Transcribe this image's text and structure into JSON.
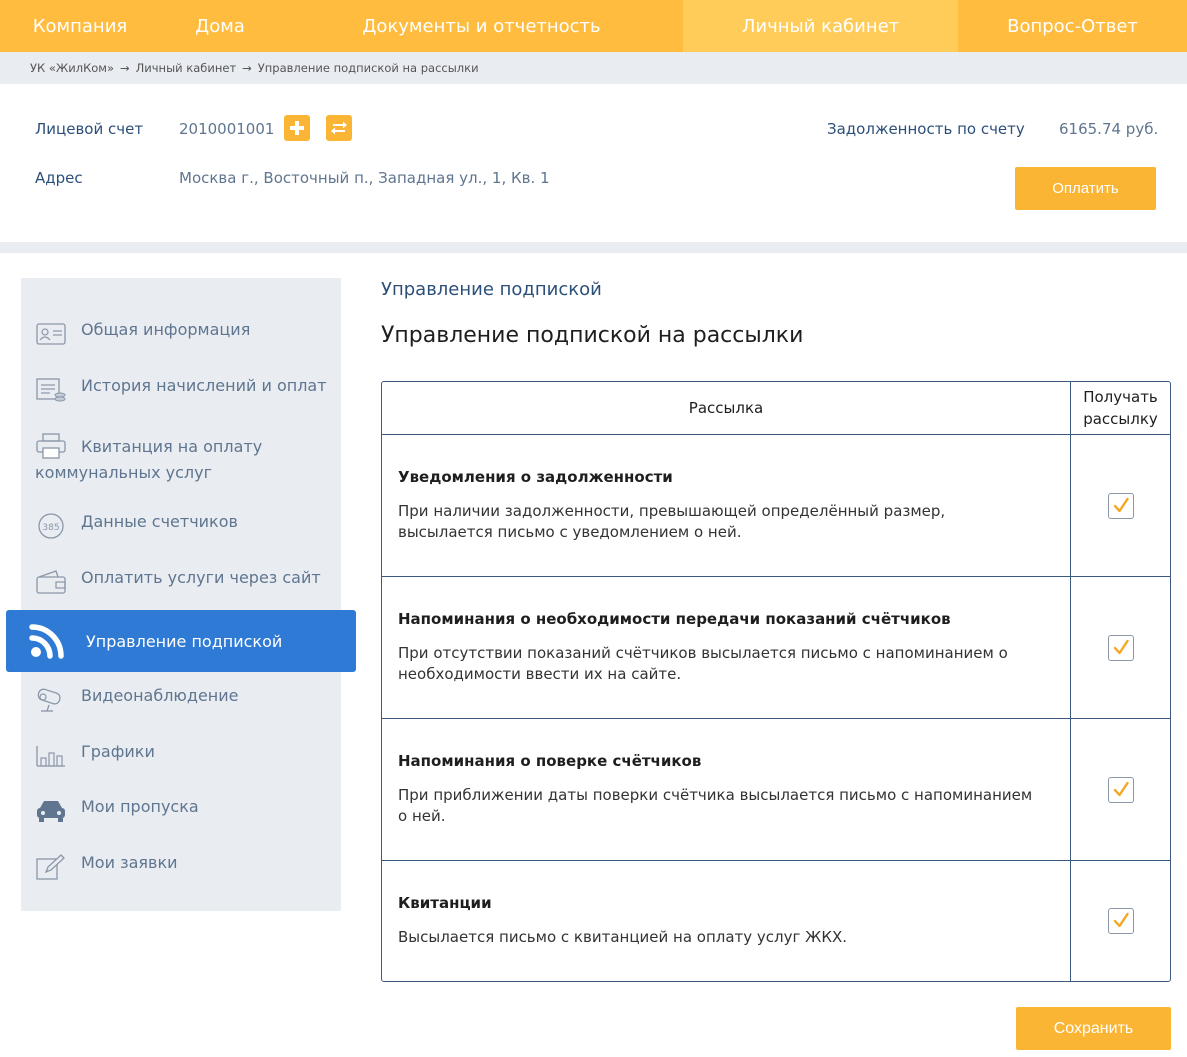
{
  "nav": {
    "items": [
      {
        "label": "Компания"
      },
      {
        "label": "Дома"
      },
      {
        "label": "Документы и отчетность"
      },
      {
        "label": "Личный кабинет"
      },
      {
        "label": "Вопрос-Ответ"
      }
    ],
    "active_index": 3
  },
  "breadcrumb": {
    "items": [
      {
        "label": "УК «ЖилКом»"
      },
      {
        "label": "Личный кабинет"
      },
      {
        "label": "Управление подпиской на рассылки"
      }
    ],
    "separator": "→"
  },
  "account": {
    "account_label": "Лицевой счет",
    "account_number": "2010001001",
    "address_label": "Адрес",
    "address_value": "Москва г., Восточный п., Западная ул., 1, Кв. 1",
    "debt_label": "Задолженность по счету",
    "debt_value": "6165.74 руб.",
    "pay_button": "Оплатить",
    "add_icon": "plus-icon",
    "switch_icon": "swap-icon"
  },
  "sidebar": {
    "items": [
      {
        "label": "Общая информация",
        "icon": "id-card-icon"
      },
      {
        "label": "История начислений и оплат",
        "icon": "history-icon"
      },
      {
        "label": "Квитанция на оплату",
        "label2": "коммунальных услуг",
        "icon": "printer-icon"
      },
      {
        "label": "Данные счетчиков",
        "icon": "meter-icon"
      },
      {
        "label": "Оплатить услуги через сайт",
        "icon": "wallet-icon"
      },
      {
        "label": "Управление подпиской",
        "icon": "rss-icon"
      },
      {
        "label": "Видеонаблюдение",
        "icon": "camera-icon"
      },
      {
        "label": "Графики",
        "icon": "chart-icon"
      },
      {
        "label": "Мои пропуска",
        "icon": "car-icon"
      },
      {
        "label": "Мои заявки",
        "icon": "edit-icon"
      }
    ],
    "active_index": 5
  },
  "page": {
    "subtitle": "Управление подпиской",
    "title": "Управление подпиской на рассылки"
  },
  "table": {
    "col_mailing": "Рассылка",
    "col_receive_line1": "Получать",
    "col_receive_line2": "рассылку",
    "rows": [
      {
        "title": "Уведомления о задолженности",
        "desc1": "При наличии задолженности, превышающей определённый размер,",
        "desc2": "высылается письмо с уведомлением о ней.",
        "checked": true
      },
      {
        "title": "Напоминания о необходимости передачи показаний счётчиков",
        "desc1": "При отсутствии показаний счётчиков высылается письмо с напоминанием о",
        "desc2": "необходимости ввести их на сайте.",
        "checked": true
      },
      {
        "title": "Напоминания о поверке счётчиков",
        "desc1": "При приближении даты поверки счётчика высылается письмо с напоминанием",
        "desc2": "о ней.",
        "checked": true
      },
      {
        "title": "Квитанции",
        "desc1": "Высылается письмо с квитанцией на оплату услуг ЖКХ.",
        "desc2": "",
        "checked": true
      }
    ]
  },
  "save_button": "Сохранить",
  "colors": {
    "accent": "#fbb534",
    "nav_bg": "#ffbc3f",
    "nav_active": "#ffcc59",
    "active_blue": "#2e7ad5",
    "dark_blue": "#2c4f7a",
    "check": "#f5a623"
  }
}
